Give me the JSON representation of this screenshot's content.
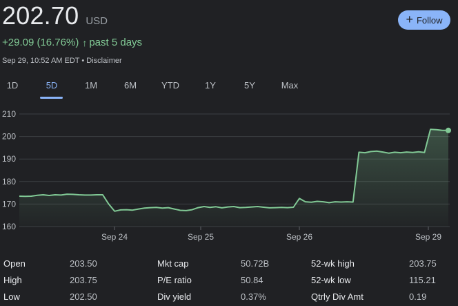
{
  "quote": {
    "price": "202.70",
    "currency": "USD",
    "change": "+29.09 (16.76%)",
    "change_arrow": "↑",
    "period": "past 5 days",
    "timestamp": "Sep 29, 10:52 AM EDT",
    "separator": "•",
    "disclaimer": "Disclaimer"
  },
  "follow_button": {
    "label": "Follow",
    "icon": "plus-icon"
  },
  "range_tabs": [
    "1D",
    "5D",
    "1M",
    "6M",
    "YTD",
    "1Y",
    "5Y",
    "Max"
  ],
  "selected_range": "5D",
  "colors": {
    "background": "#202124",
    "accent": "#8ab4f8",
    "positive": "#81c995"
  },
  "chart_data": {
    "type": "area",
    "y_ticks": [
      160,
      170,
      180,
      190,
      200,
      210
    ],
    "ylim": [
      160,
      210
    ],
    "x_tick_labels": [
      "Sep 24",
      "Sep 25",
      "Sep 26",
      "Sep 29"
    ],
    "grid": true,
    "series": [
      {
        "values": [
          173.5,
          173.4,
          173.5,
          173.9,
          174.1,
          173.8,
          174.1,
          174.0,
          174.4,
          174.3,
          174.1,
          174.0,
          174.0,
          174.1,
          174.1,
          170.0,
          166.8,
          167.4,
          167.5,
          167.3,
          167.8,
          168.2,
          168.4,
          168.5,
          168.2,
          168.4,
          167.8,
          167.2,
          167.1,
          167.5,
          168.4,
          168.9,
          168.5,
          168.8,
          168.3,
          168.7,
          168.9,
          168.4,
          168.5,
          168.7,
          168.9,
          168.6,
          168.3,
          168.4,
          168.5,
          168.4,
          168.6,
          172.5,
          171.0,
          170.8,
          171.2,
          171.0,
          170.6,
          171.0,
          170.9,
          171.0,
          170.9,
          193.0,
          192.8,
          193.3,
          193.5,
          193.1,
          192.6,
          193.0,
          192.8,
          193.1,
          192.9,
          193.2,
          192.9,
          203.2,
          203.0,
          202.7,
          202.7
        ]
      }
    ]
  },
  "stats": {
    "col1": [
      {
        "label": "Open",
        "value": "203.50"
      },
      {
        "label": "High",
        "value": "203.75"
      },
      {
        "label": "Low",
        "value": "202.50"
      }
    ],
    "col2": [
      {
        "label": "Mkt cap",
        "value": "50.72B"
      },
      {
        "label": "P/E ratio",
        "value": "50.84"
      },
      {
        "label": "Div yield",
        "value": "0.37%"
      }
    ],
    "col3": [
      {
        "label": "52-wk high",
        "value": "203.75"
      },
      {
        "label": "52-wk low",
        "value": "115.21"
      },
      {
        "label": "Qtrly Div Amt",
        "value": "0.19"
      }
    ]
  }
}
